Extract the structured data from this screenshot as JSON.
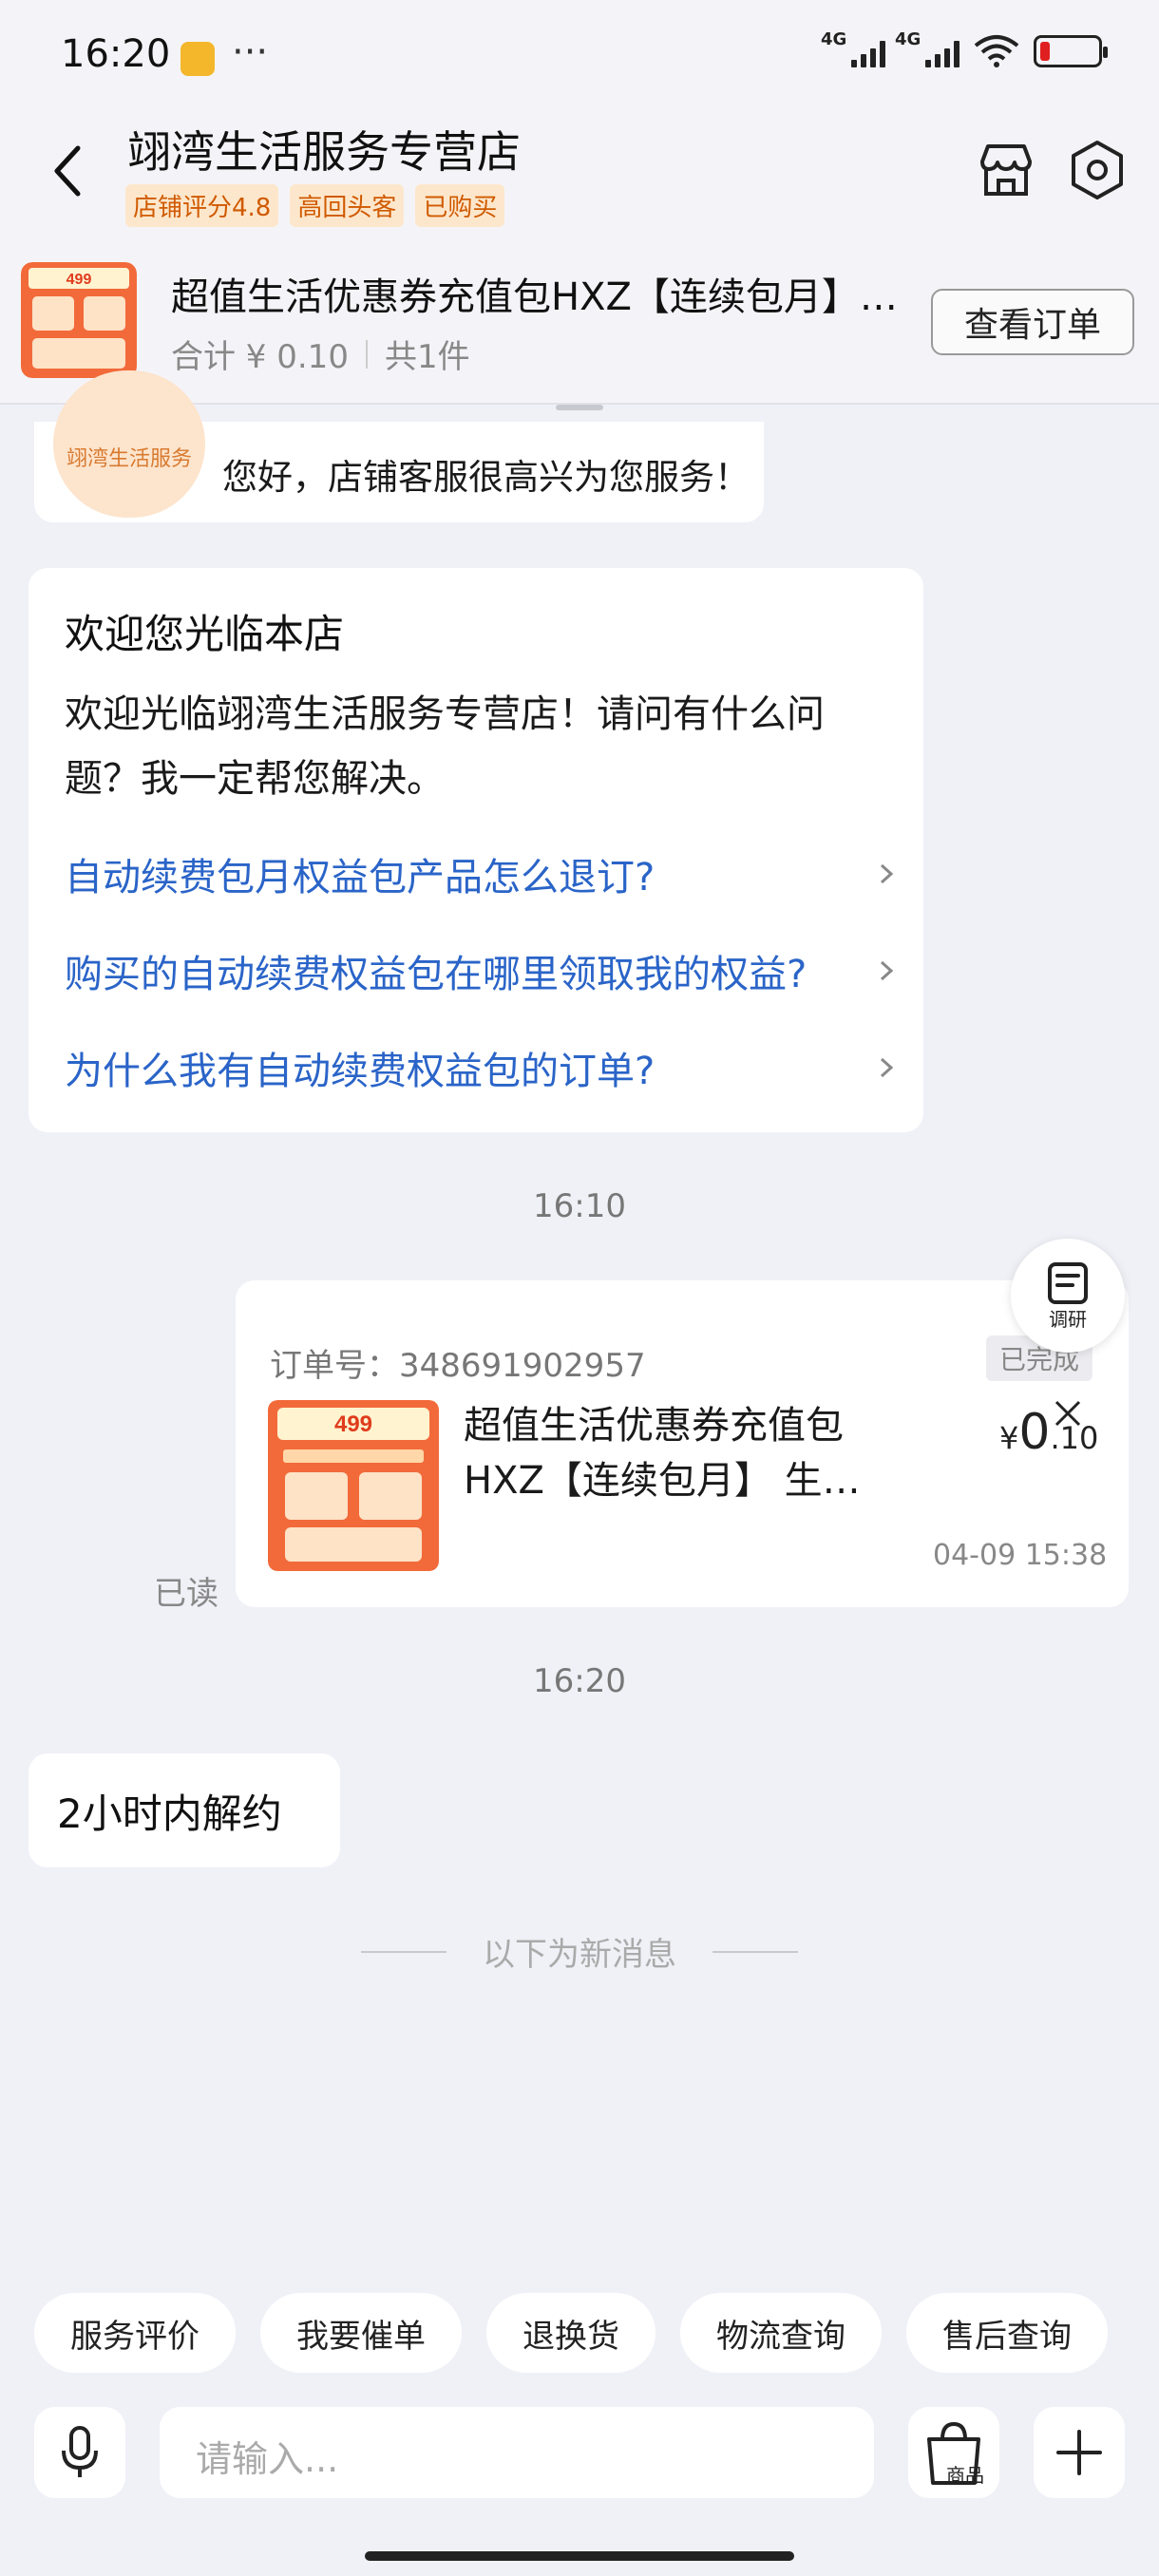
{
  "status": {
    "time": "16:20",
    "dots": "···",
    "net1": "4G",
    "net2": "4G"
  },
  "header": {
    "shop_name": "翊湾生活服务专营店",
    "tags": [
      "店铺评分4.8",
      "高回头客",
      "已购买"
    ]
  },
  "order_bar": {
    "title": "超值生活优惠券充值包HXZ【连续包月】生活权益",
    "total": "合计 ¥ 0.10",
    "count": "共1件",
    "view_button": "查看订单"
  },
  "greeting": {
    "avatar_text": "翊湾生活服务",
    "text": "您好，店铺客服很高兴为您服务！"
  },
  "welcome": {
    "title": "欢迎您光临本店",
    "body": "欢迎光临翊湾生活服务专营店！请问有什么问题？我一定帮您解决。",
    "faqs": [
      "自动续费包月权益包产品怎么退订?",
      "购买的自动续费权益包在哪里领取我的权益?",
      "为什么我有自动续费权益包的订单?"
    ]
  },
  "time1": "16:10",
  "survey_label": "调研",
  "read_label": "已读",
  "order_card": {
    "order_no": "订单号：348691902957",
    "status": "已完成",
    "title": "超值生活优惠券充值包HXZ【连续包月】 生…",
    "price_symbol": "¥",
    "price_int": "0",
    "price_dec": ".10",
    "date": "04-09 15:38"
  },
  "time2": "16:20",
  "my_message": "2小时内解约",
  "new_divider": "以下为新消息",
  "quick_actions": [
    "服务评价",
    "我要催单",
    "退换货",
    "物流查询",
    "售后查询"
  ],
  "input": {
    "placeholder": "请输入...",
    "goods_label": "商品"
  },
  "colors": {
    "tag_bg": "#fde7cc",
    "tag_fg": "#d05a00",
    "link": "#2a64c8",
    "background": "#f0f1f7"
  },
  "icons": [
    "back-arrow-icon",
    "store-icon",
    "settings-hexagon-icon",
    "chevron-right-icon",
    "survey-icon",
    "close-icon",
    "mic-icon",
    "emoji-icon",
    "shopping-bag-icon",
    "plus-icon"
  ]
}
